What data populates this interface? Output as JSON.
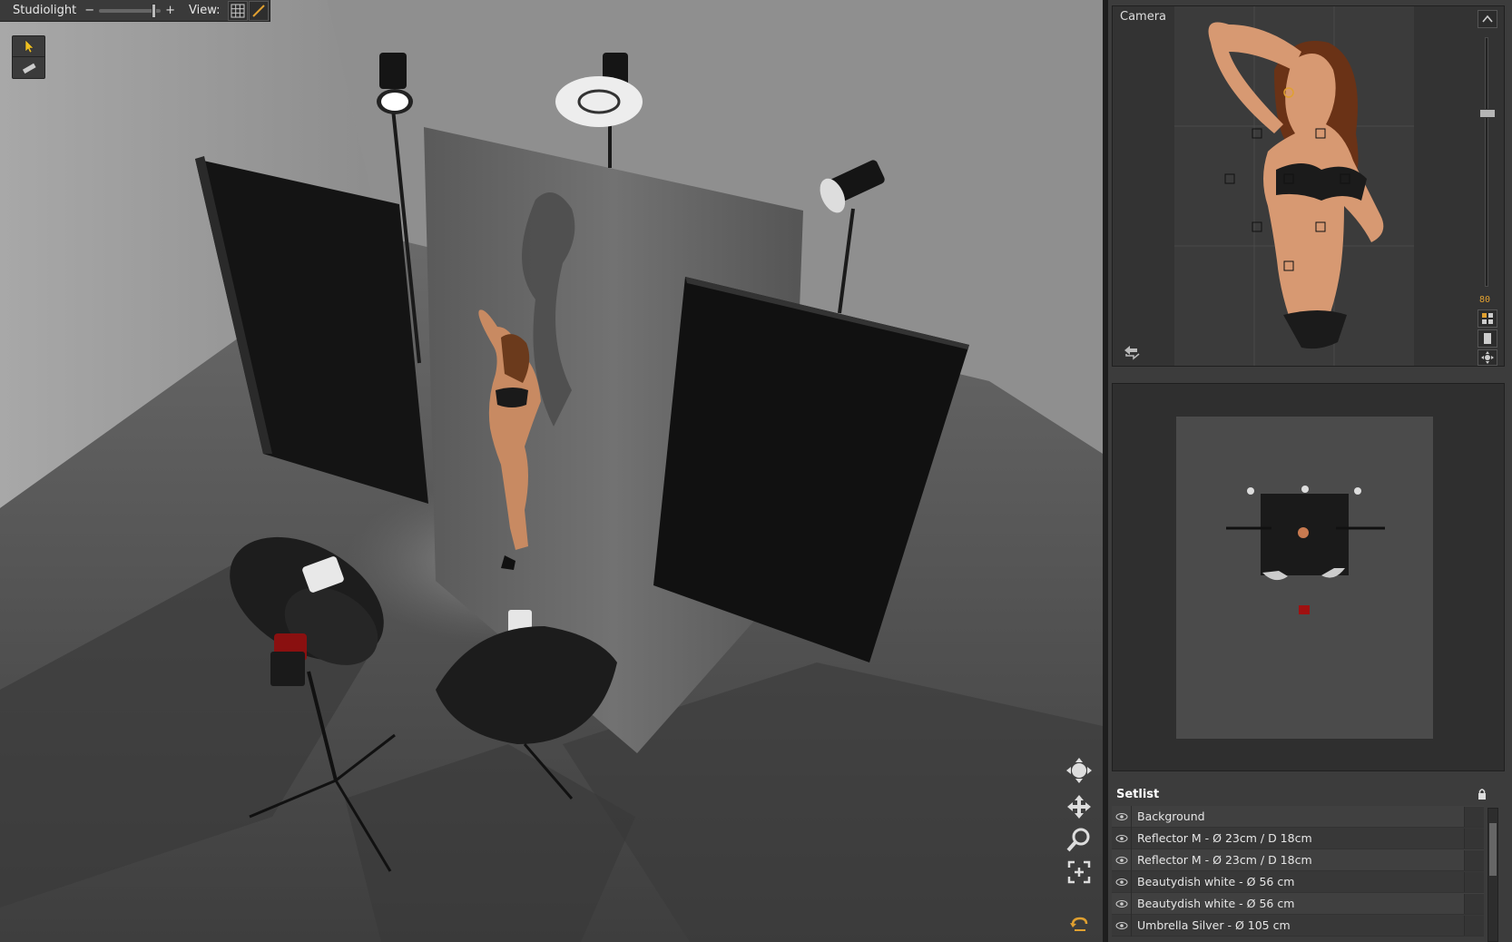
{
  "app": {
    "title": "Studiolight",
    "zoom_minus": "−",
    "zoom_plus": "+",
    "view_label": "View:"
  },
  "camera": {
    "label": "Camera",
    "focal_readout": "80"
  },
  "setlist": {
    "title": "Setlist",
    "items": [
      {
        "label": "Background"
      },
      {
        "label": "Reflector M - Ø 23cm / D 18cm"
      },
      {
        "label": "Reflector M - Ø 23cm / D 18cm"
      },
      {
        "label": "Beautydish white - Ø 56 cm"
      },
      {
        "label": "Beautydish white - Ø 56 cm"
      },
      {
        "label": "Umbrella Silver - Ø 105 cm"
      }
    ]
  },
  "colors": {
    "accent_orange": "#e0a030",
    "select_tool": "#f0c020",
    "panel_bg": "#3c3c3c"
  },
  "icons": [
    "grid-icon",
    "line-icon",
    "pointer-icon",
    "ruler-icon",
    "orbit-icon",
    "pan-icon",
    "zoom-icon",
    "fit-icon",
    "reset-icon",
    "swap-icon",
    "lock-icon",
    "eye-icon"
  ]
}
